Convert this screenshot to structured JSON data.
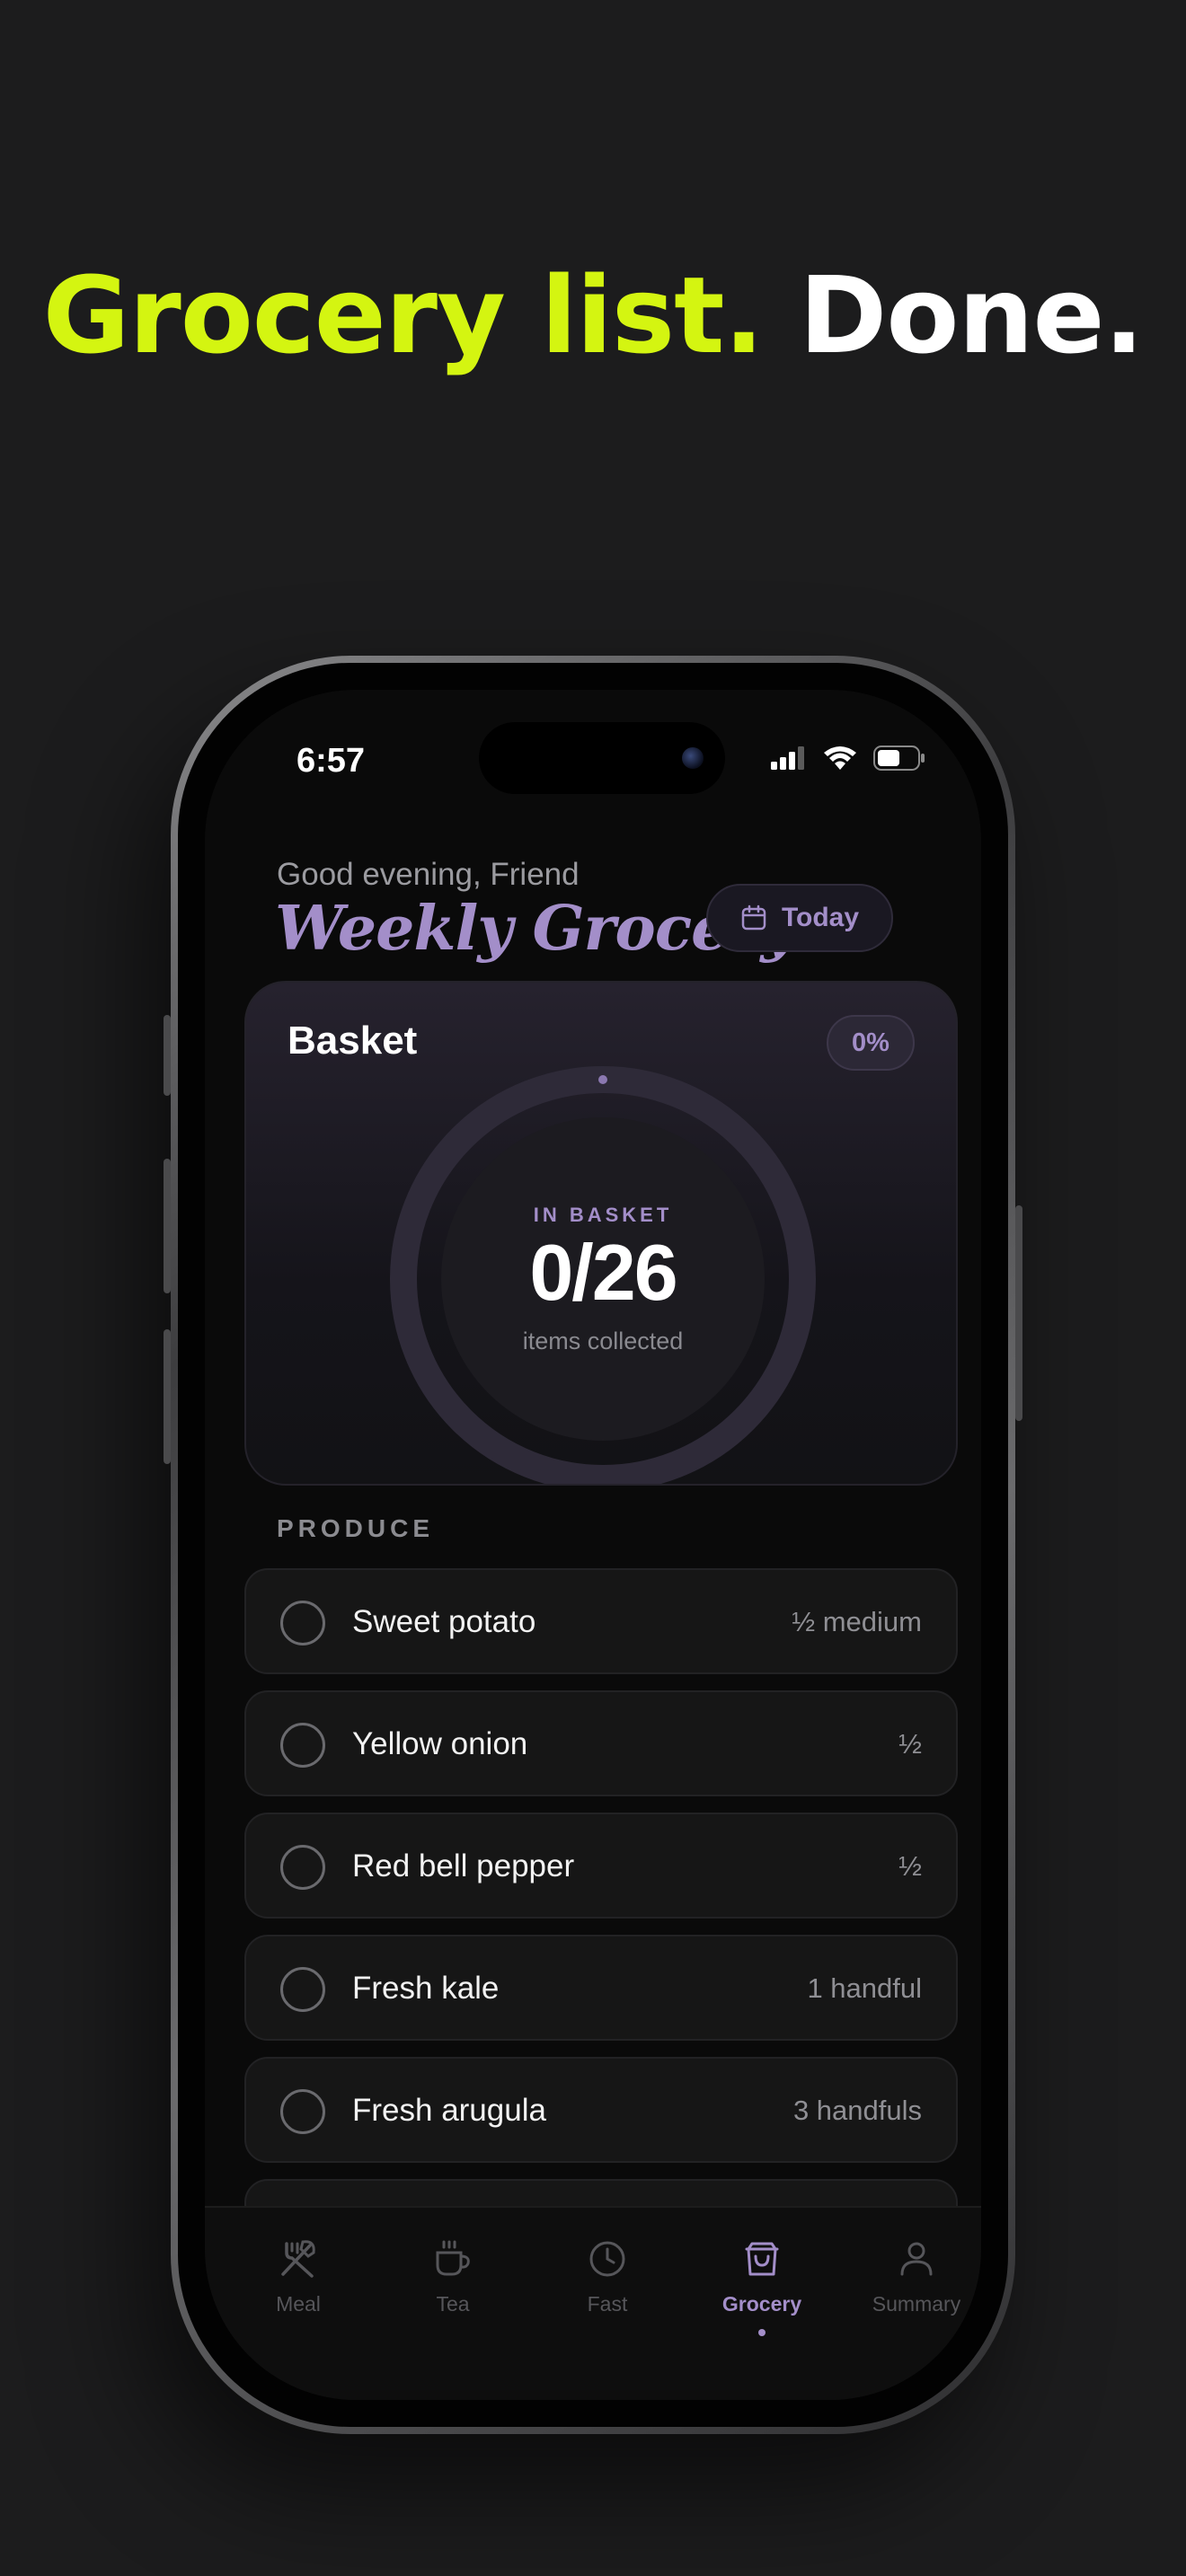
{
  "headline": {
    "accent": "Grocery list.",
    "rest": "Done."
  },
  "status_bar": {
    "time": "6:57"
  },
  "header": {
    "greeting": "Good evening, Friend",
    "title": "Weekly Grocery.",
    "today_label": "Today"
  },
  "basket": {
    "title": "Basket",
    "percent_label": "0%",
    "kicker": "IN BASKET",
    "count": "0/26",
    "sub": "items collected",
    "progress_fraction": 0
  },
  "section": {
    "label": "PRODUCE"
  },
  "items": [
    {
      "name": "Sweet potato",
      "qty": "½ medium"
    },
    {
      "name": "Yellow onion",
      "qty": "½"
    },
    {
      "name": "Red bell pepper",
      "qty": "½"
    },
    {
      "name": "Fresh kale",
      "qty": "1 handful"
    },
    {
      "name": "Fresh arugula",
      "qty": "3 handfuls"
    }
  ],
  "tabs": [
    {
      "label": "Meal",
      "icon": "fork-knife-icon"
    },
    {
      "label": "Tea",
      "icon": "cup-icon"
    },
    {
      "label": "Fast",
      "icon": "clock-icon"
    },
    {
      "label": "Grocery",
      "icon": "shopping-bag-icon",
      "active": true
    },
    {
      "label": "Summary",
      "icon": "person-icon"
    }
  ],
  "colors": {
    "accent_lime": "#d4f511",
    "accent_purple": "#a38ec9"
  }
}
